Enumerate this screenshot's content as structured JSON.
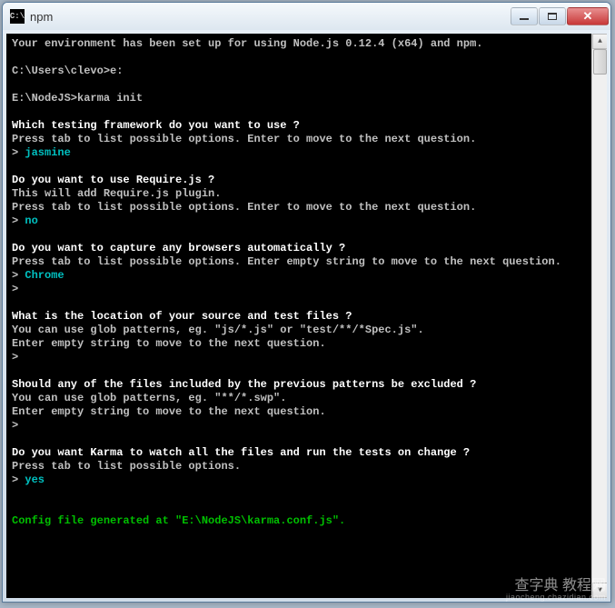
{
  "window": {
    "title": "npm",
    "icon_label": "C:\\"
  },
  "terminal": {
    "lines": [
      {
        "segments": [
          {
            "text": "Your environment has been set up for using Node.js 0.12.4 (x64) and npm.",
            "cls": "gray"
          }
        ]
      },
      {
        "segments": [
          {
            "text": "",
            "cls": "gray"
          }
        ]
      },
      {
        "segments": [
          {
            "text": "C:\\Users\\clevo>e:",
            "cls": "gray"
          }
        ]
      },
      {
        "segments": [
          {
            "text": "",
            "cls": "gray"
          }
        ]
      },
      {
        "segments": [
          {
            "text": "E:\\NodeJS>karma init",
            "cls": "gray"
          }
        ]
      },
      {
        "segments": [
          {
            "text": "",
            "cls": "gray"
          }
        ]
      },
      {
        "segments": [
          {
            "text": "Which testing framework do you want to use ?",
            "cls": "white"
          }
        ]
      },
      {
        "segments": [
          {
            "text": "Press tab to list possible options. Enter to move to the next question.",
            "cls": "gray"
          }
        ]
      },
      {
        "segments": [
          {
            "text": "> ",
            "cls": "gray"
          },
          {
            "text": "jasmine",
            "cls": "cyan"
          }
        ]
      },
      {
        "segments": [
          {
            "text": "",
            "cls": "gray"
          }
        ]
      },
      {
        "segments": [
          {
            "text": "Do you want to use Require.js ?",
            "cls": "white"
          }
        ]
      },
      {
        "segments": [
          {
            "text": "This will add Require.js plugin.",
            "cls": "gray"
          }
        ]
      },
      {
        "segments": [
          {
            "text": "Press tab to list possible options. Enter to move to the next question.",
            "cls": "gray"
          }
        ]
      },
      {
        "segments": [
          {
            "text": "> ",
            "cls": "gray"
          },
          {
            "text": "no",
            "cls": "cyan"
          }
        ]
      },
      {
        "segments": [
          {
            "text": "",
            "cls": "gray"
          }
        ]
      },
      {
        "segments": [
          {
            "text": "Do you want to capture any browsers automatically ?",
            "cls": "white"
          }
        ]
      },
      {
        "segments": [
          {
            "text": "Press tab to list possible options. Enter empty string to move to the next question.",
            "cls": "gray"
          }
        ]
      },
      {
        "segments": [
          {
            "text": "> ",
            "cls": "gray"
          },
          {
            "text": "Chrome",
            "cls": "cyan"
          }
        ]
      },
      {
        "segments": [
          {
            "text": ">",
            "cls": "gray"
          }
        ]
      },
      {
        "segments": [
          {
            "text": "",
            "cls": "gray"
          }
        ]
      },
      {
        "segments": [
          {
            "text": "What is the location of your source and test files ?",
            "cls": "white"
          }
        ]
      },
      {
        "segments": [
          {
            "text": "You can use glob patterns, eg. \"js/*.js\" or \"test/**/*Spec.js\".",
            "cls": "gray"
          }
        ]
      },
      {
        "segments": [
          {
            "text": "Enter empty string to move to the next question.",
            "cls": "gray"
          }
        ]
      },
      {
        "segments": [
          {
            "text": ">",
            "cls": "gray"
          }
        ]
      },
      {
        "segments": [
          {
            "text": "",
            "cls": "gray"
          }
        ]
      },
      {
        "segments": [
          {
            "text": "Should any of the files included by the previous patterns be excluded ?",
            "cls": "white"
          }
        ]
      },
      {
        "segments": [
          {
            "text": "You can use glob patterns, eg. \"**/*.swp\".",
            "cls": "gray"
          }
        ]
      },
      {
        "segments": [
          {
            "text": "Enter empty string to move to the next question.",
            "cls": "gray"
          }
        ]
      },
      {
        "segments": [
          {
            "text": ">",
            "cls": "gray"
          }
        ]
      },
      {
        "segments": [
          {
            "text": "",
            "cls": "gray"
          }
        ]
      },
      {
        "segments": [
          {
            "text": "Do you want Karma to watch all the files and run the tests on change ?",
            "cls": "white"
          }
        ]
      },
      {
        "segments": [
          {
            "text": "Press tab to list possible options.",
            "cls": "gray"
          }
        ]
      },
      {
        "segments": [
          {
            "text": "> ",
            "cls": "gray"
          },
          {
            "text": "yes",
            "cls": "cyan"
          }
        ]
      },
      {
        "segments": [
          {
            "text": "",
            "cls": "gray"
          }
        ]
      },
      {
        "segments": [
          {
            "text": "",
            "cls": "gray"
          }
        ]
      },
      {
        "segments": [
          {
            "text": "Config file generated at \"E:\\NodeJS\\karma.conf.js\".",
            "cls": "green"
          }
        ]
      },
      {
        "segments": [
          {
            "text": "",
            "cls": "gray"
          }
        ]
      }
    ]
  },
  "watermark": {
    "main": "查字典 教程网",
    "sub": "jiaocheng.chazidian.com"
  }
}
